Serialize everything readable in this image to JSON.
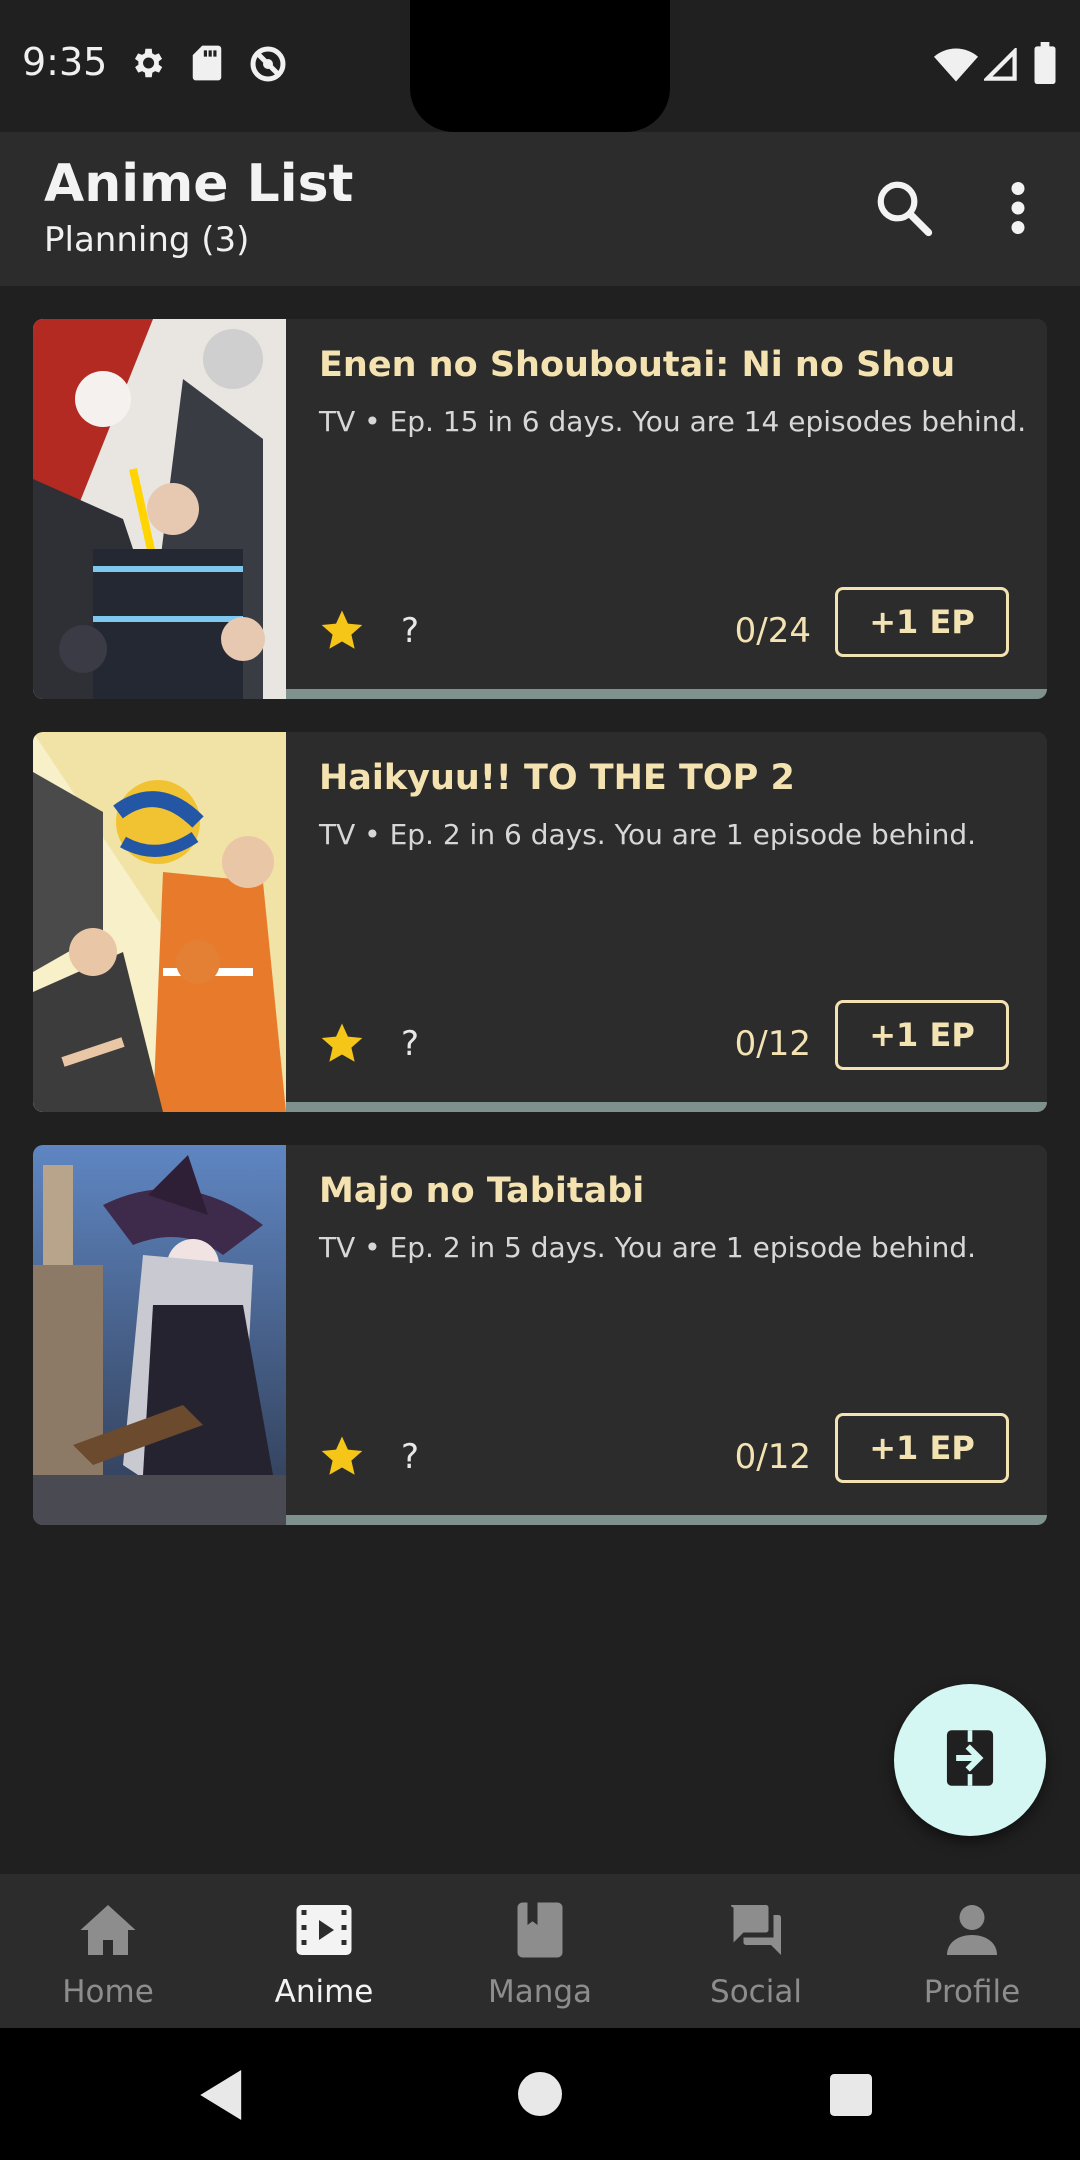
{
  "status_bar": {
    "time": "9:35",
    "left_icons": [
      "gear-icon",
      "sd-card-icon",
      "do-not-disturb-icon"
    ],
    "right_icons": [
      "wifi-icon",
      "cell-signal-icon",
      "battery-icon"
    ]
  },
  "app_bar": {
    "title": "Anime List",
    "subtitle": "Planning (3)",
    "actions": [
      "search-icon",
      "more-vert-icon"
    ]
  },
  "entries": [
    {
      "title": "Enen no Shouboutai: Ni no Shou",
      "subtitle": "TV • Ep. 15 in 6 days. You are 14 episodes behind.",
      "score": "?",
      "progress": "0/24",
      "button": "+1 EP"
    },
    {
      "title": "Haikyuu!! TO THE TOP 2",
      "subtitle": "TV • Ep. 2 in 6 days. You are 1 episode behind.",
      "score": "?",
      "progress": "0/12",
      "button": "+1 EP"
    },
    {
      "title": "Majo no Tabitabi",
      "subtitle": "TV • Ep. 2 in 5 days. You are 1 episode behind.",
      "score": "?",
      "progress": "0/12",
      "button": "+1 EP"
    }
  ],
  "fab": {
    "icon": "switch-list-icon"
  },
  "bottom_nav": [
    {
      "label": "Home",
      "icon": "home-icon",
      "active": false
    },
    {
      "label": "Anime",
      "icon": "anime-icon",
      "active": true
    },
    {
      "label": "Manga",
      "icon": "book-icon",
      "active": false
    },
    {
      "label": "Social",
      "icon": "chat-icon",
      "active": false
    },
    {
      "label": "Profile",
      "icon": "person-icon",
      "active": false
    }
  ],
  "colors": {
    "accent": "#f4e3b1",
    "star": "#f5c518",
    "fab": "#d5f7f3",
    "surface": "#2c2c2c",
    "background": "#202020"
  }
}
